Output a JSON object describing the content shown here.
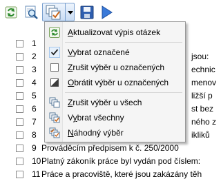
{
  "toolbar": {
    "refresh": "refresh-icon",
    "search": "search-icon",
    "checks": "multi-check-icon",
    "save": "save-icon",
    "next": "play-icon"
  },
  "menu": {
    "items": [
      {
        "label": "Aktualizovat výpis otázek",
        "u": "A",
        "icon": "refresh-icon"
      },
      {
        "label": "Vybrat označené",
        "u": "V",
        "icon": "check-icon"
      },
      {
        "label": "Zrušit výběr u označených",
        "u": "Z",
        "icon": "empty-checkbox-icon"
      },
      {
        "label": "Obrátit výběr u označených",
        "u": "O",
        "icon": "invert-selection-icon"
      },
      {
        "label": "Zrušit výběr u všech",
        "u": "Z",
        "icon": "unselect-all-icon"
      },
      {
        "label": "Vybrat všechny",
        "u": "y",
        "icon": "select-all-icon"
      },
      {
        "label": "Náhodný výběr",
        "u": "N",
        "icon": "random-select-icon"
      }
    ]
  },
  "list": {
    "rows": [
      {
        "num": "1",
        "text": "",
        "rtext": ""
      },
      {
        "num": "2",
        "text": "",
        "rtext": "jsou:"
      },
      {
        "num": "3",
        "text": "",
        "rtext": "echnic"
      },
      {
        "num": "4",
        "text": "",
        "rtext": "menov"
      },
      {
        "num": "5",
        "text": "",
        "rtext": "ližší p"
      },
      {
        "num": "6",
        "text": "",
        "rtext": "st bez"
      },
      {
        "num": "7",
        "text": "",
        "rtext": "ného z"
      },
      {
        "num": "8",
        "text": "",
        "rtext": "ikliků"
      },
      {
        "num": "9",
        "text": "Prováděcím předpisem k č. 250/2000",
        "rtext": ""
      },
      {
        "num": "10",
        "text": "Platný zákoník práce byl vydán pod číslem:",
        "rtext": ""
      },
      {
        "num": "11",
        "text": "Práce a pracoviště, které jsou zakázány těh",
        "rtext": ""
      }
    ]
  }
}
